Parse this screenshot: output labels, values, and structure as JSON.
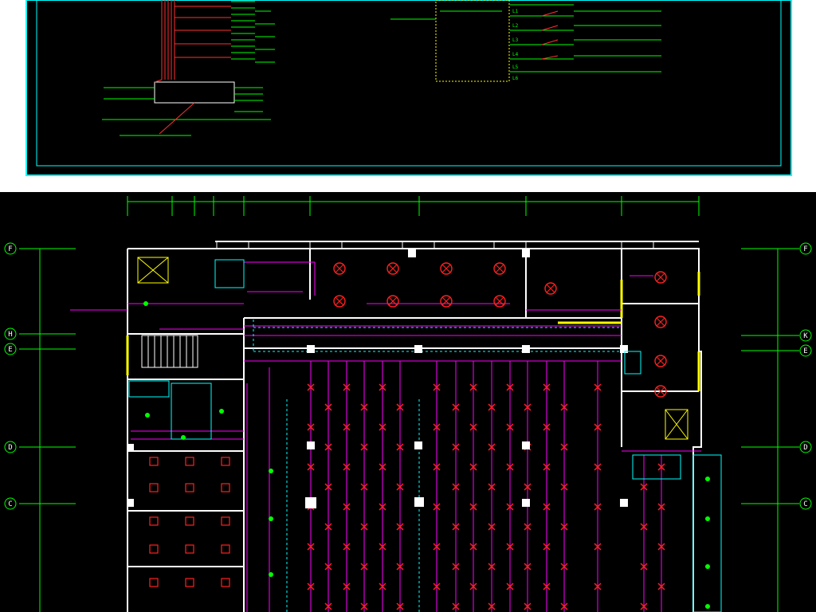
{
  "drawing": {
    "top_titles": {
      "riser_diagram_title": "",
      "lighting_circuit_title": ""
    },
    "riser_board_label": "",
    "lighting_panel_circuits": [
      "L1",
      "L2",
      "L3",
      "L4",
      "L5",
      "L6"
    ],
    "plan": {
      "grid_axes_left": [
        "F",
        "H",
        "E",
        "D",
        "C"
      ],
      "grid_axes_right": [
        "F",
        "K",
        "E",
        "D",
        "C"
      ],
      "column_dimensions": [
        "",
        "",
        "",
        "",
        "",
        "",
        "",
        ""
      ],
      "row_dimensions_left": [
        "",
        "",
        "",
        "",
        "",
        ""
      ],
      "row_dimensions_right": [
        "",
        "",
        "",
        "",
        "",
        ""
      ],
      "room_labels": [
        "",
        "",
        "",
        "",
        "",
        "",
        "",
        "",
        ""
      ],
      "feeder_labels": [
        "",
        "",
        ""
      ]
    },
    "colors": {
      "background": "#000000",
      "frame": "#00ffff",
      "wiring": "#ff00ff",
      "lights": "#ff0000",
      "text": "#00ff00",
      "wall": "#ffffff",
      "accent": "#ffff00"
    }
  }
}
